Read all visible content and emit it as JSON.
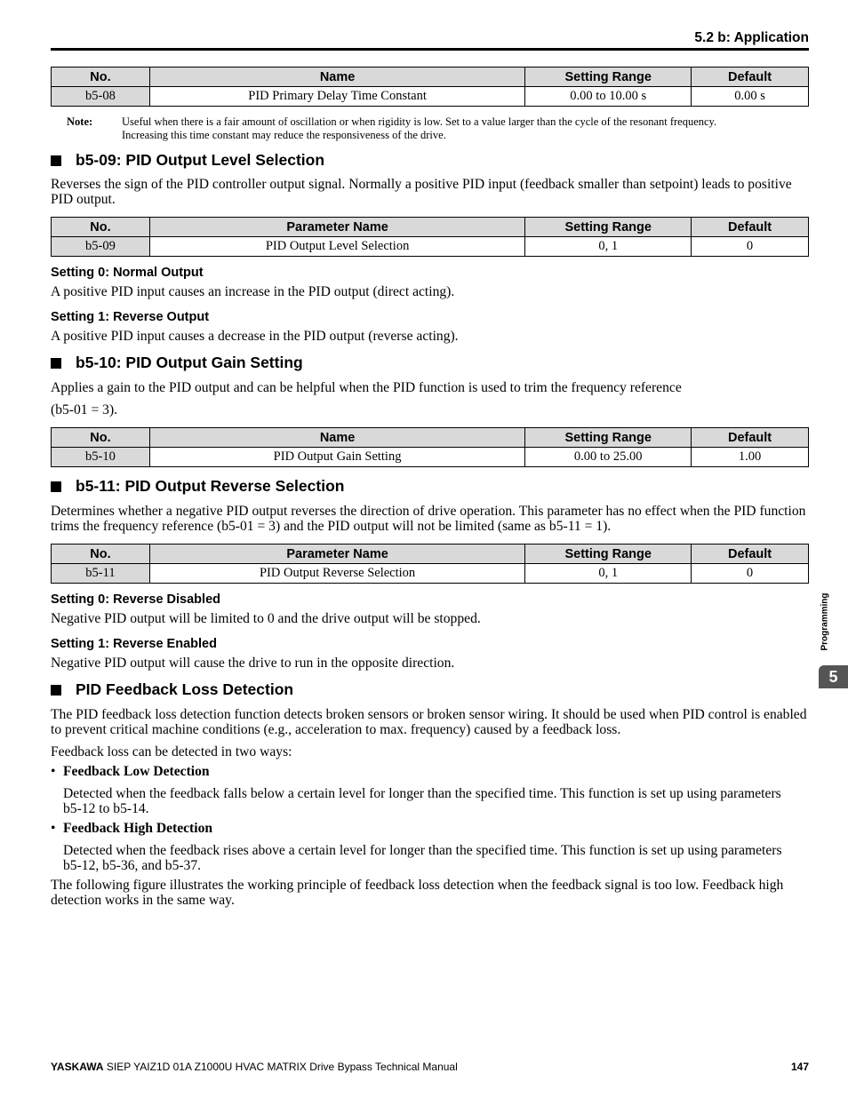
{
  "running_head": "5.2 b: Application",
  "side_tab": {
    "label": "Programming",
    "chapter": "5"
  },
  "table_b5_08": {
    "headers": [
      "No.",
      "Name",
      "Setting Range",
      "Default"
    ],
    "row": [
      "b5-08",
      "PID Primary Delay Time Constant",
      "0.00 to 10.00 s",
      "0.00 s"
    ]
  },
  "note": {
    "label": "Note:",
    "line1": "Useful when there is a fair amount of oscillation or when rigidity is low. Set to a value larger than the cycle of the resonant frequency.",
    "line2": "Increasing this time constant may reduce the responsiveness of the drive."
  },
  "b5_09": {
    "heading": "b5-09: PID Output Level Selection",
    "intro": "Reverses the sign of the PID controller output signal. Normally a positive PID input (feedback smaller than setpoint) leads to positive PID output.",
    "table": {
      "headers": [
        "No.",
        "Parameter Name",
        "Setting Range",
        "Default"
      ],
      "row": [
        "b5-09",
        "PID Output Level Selection",
        "0, 1",
        "0"
      ]
    },
    "settings": [
      {
        "title": "Setting 0: Normal Output",
        "text": "A positive PID input causes an increase in the PID output (direct acting)."
      },
      {
        "title": "Setting 1: Reverse Output",
        "text": "A positive PID input causes a decrease in the PID output (reverse acting)."
      }
    ]
  },
  "b5_10": {
    "heading": "b5-10: PID Output Gain Setting",
    "intro_line1": "Applies a gain to the PID output and can be helpful when the PID function is used to trim the frequency reference",
    "intro_line2": "(b5-01 = 3).",
    "table": {
      "headers": [
        "No.",
        "Name",
        "Setting Range",
        "Default"
      ],
      "row": [
        "b5-10",
        "PID Output Gain Setting",
        "0.00 to 25.00",
        "1.00"
      ]
    }
  },
  "b5_11": {
    "heading": "b5-11: PID Output Reverse Selection",
    "intro": "Determines whether a negative PID output reverses the direction of drive operation. This parameter has no effect when the PID function trims the frequency reference (b5-01 = 3) and the PID output will not be limited (same as b5-11 = 1).",
    "table": {
      "headers": [
        "No.",
        "Parameter Name",
        "Setting Range",
        "Default"
      ],
      "row": [
        "b5-11",
        "PID Output Reverse Selection",
        "0, 1",
        "0"
      ]
    },
    "settings": [
      {
        "title": "Setting 0: Reverse Disabled",
        "text": "Negative PID output will be limited to 0 and the drive output will be stopped."
      },
      {
        "title": "Setting 1: Reverse Enabled",
        "text": "Negative PID output will cause the drive to run in the opposite direction."
      }
    ]
  },
  "feedback_loss": {
    "heading": "PID Feedback Loss Detection",
    "intro": "The PID feedback loss detection function detects broken sensors or broken sensor wiring. It should be used when PID control is enabled to prevent critical machine conditions (e.g., acceleration to max. frequency) caused by a feedback loss.",
    "ways": "Feedback loss can be detected in two ways:",
    "bullets": [
      {
        "title": "Feedback Low Detection",
        "text": "Detected when the feedback falls below a certain level for longer than the specified time. This function is set up using parameters b5-12 to b5-14."
      },
      {
        "title": "Feedback High Detection",
        "text": "Detected when the feedback rises above a certain level for longer than the specified time. This function is set up using parameters b5-12, b5-36, and b5-37."
      }
    ],
    "closing": "The following figure illustrates the working principle of feedback loss detection when the feedback signal is too low. Feedback high detection works in the same way."
  },
  "footer": {
    "brand": "YASKAWA",
    "title": "SIEP YAIZ1D 01A Z1000U HVAC MATRIX Drive Bypass Technical Manual",
    "page": "147"
  }
}
